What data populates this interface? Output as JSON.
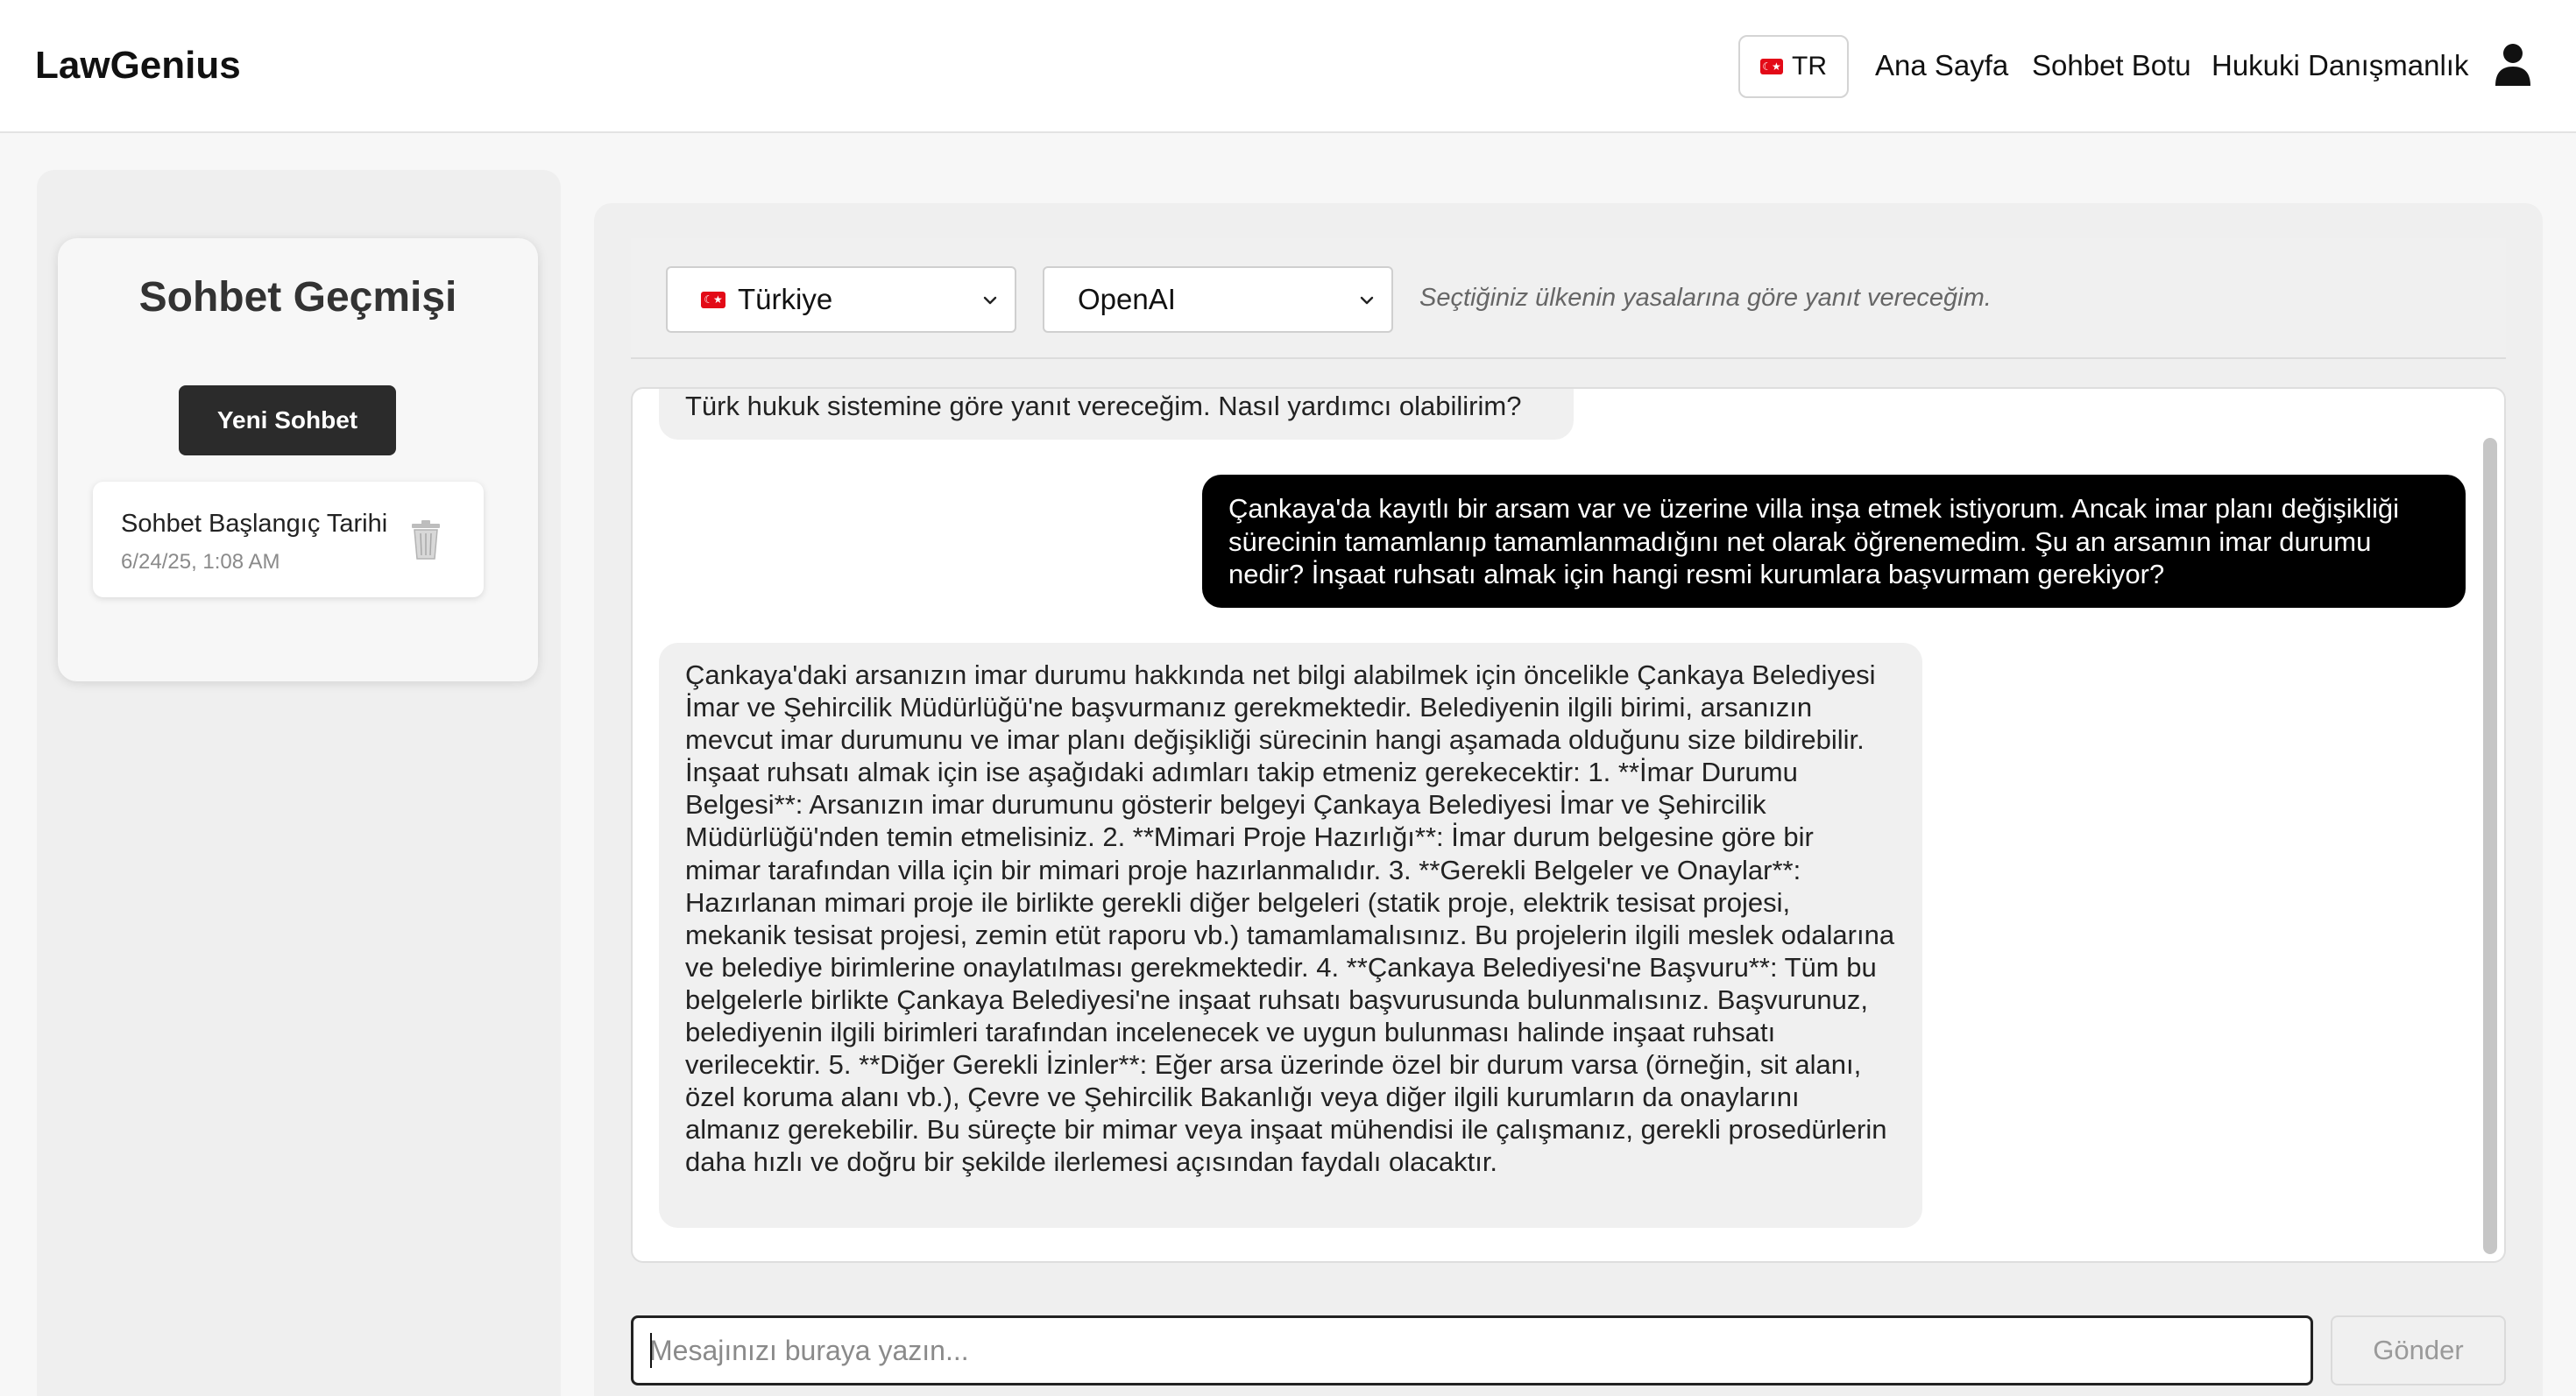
{
  "header": {
    "logo": "LawGenius",
    "language_code": "TR",
    "flag_label": "☾★",
    "nav": [
      "Ana Sayfa",
      "Sohbet Botu",
      "Hukuki Danışmanlık"
    ],
    "user_icon": "user-icon"
  },
  "sidebar": {
    "title": "Sohbet Geçmişi",
    "new_chat_label": "Yeni Sohbet",
    "sessions": [
      {
        "title": "Sohbet Başlangıç Tarihi",
        "date": "6/24/25, 1:08 AM",
        "icon": "trash-icon"
      }
    ]
  },
  "controls": {
    "country": "Türkiye",
    "model": "OpenAI",
    "info": "Seçtiğiniz ülkenin yasalarına göre yanıt vereceğim."
  },
  "chat": {
    "messages": [
      {
        "role": "bot",
        "text": "Türk hukuk sistemine göre yanıt vereceğim. Nasıl yardımcı olabilirim?"
      },
      {
        "role": "user",
        "text": "Çankaya'da kayıtlı bir arsam var ve üzerine villa inşa etmek istiyorum. Ancak imar planı değişikliği sürecinin tamamlanıp tamamlanmadığını net olarak öğrenemedim. Şu an arsamın imar durumu nedir? İnşaat ruhsatı almak için hangi resmi kurumlara başvurmam gerekiyor?"
      },
      {
        "role": "bot",
        "text": "Çankaya'daki arsanızın imar durumu hakkında net bilgi alabilmek için öncelikle Çankaya Belediyesi İmar ve Şehircilik Müdürlüğü'ne başvurmanız gerekmektedir. Belediyenin ilgili birimi, arsanızın mevcut imar durumunu ve imar planı değişikliği sürecinin hangi aşamada olduğunu size bildirebilir. İnşaat ruhsatı almak için ise aşağıdaki adımları takip etmeniz gerekecektir: 1. **İmar Durumu Belgesi**: Arsanızın imar durumunu gösterir belgeyi Çankaya Belediyesi İmar ve Şehircilik Müdürlüğü'nden temin etmelisiniz. 2. **Mimari Proje Hazırlığı**: İmar durum belgesine göre bir mimar tarafından villa için bir mimari proje hazırlanmalıdır. 3. **Gerekli Belgeler ve Onaylar**: Hazırlanan mimari proje ile birlikte gerekli diğer belgeleri (statik proje, elektrik tesisat projesi, mekanik tesisat projesi, zemin etüt raporu vb.) tamamlamalısınız. Bu projelerin ilgili meslek odalarına ve belediye birimlerine onaylatılması gerekmektedir. 4. **Çankaya Belediyesi'ne Başvuru**: Tüm bu belgelerle birlikte Çankaya Belediyesi'ne inşaat ruhsatı başvurusunda bulunmalısınız. Başvurunuz, belediyenin ilgili birimleri tarafından incelenecek ve uygun bulunması halinde inşaat ruhsatı verilecektir. 5. **Diğer Gerekli İzinler**: Eğer arsa üzerinde özel bir durum varsa (örneğin, sit alanı, özel koruma alanı vb.), Çevre ve Şehircilik Bakanlığı veya diğer ilgili kurumların da onaylarını almanız gerekebilir. Bu süreçte bir mimar veya inşaat mühendisi ile çalışmanız, gerekli prosedürlerin daha hızlı ve doğru bir şekilde ilerlemesi açısından faydalı olacaktır."
      }
    ]
  },
  "composer": {
    "placeholder": "Mesajınızı buraya yazın...",
    "value": "",
    "send_label": "Gönder"
  }
}
